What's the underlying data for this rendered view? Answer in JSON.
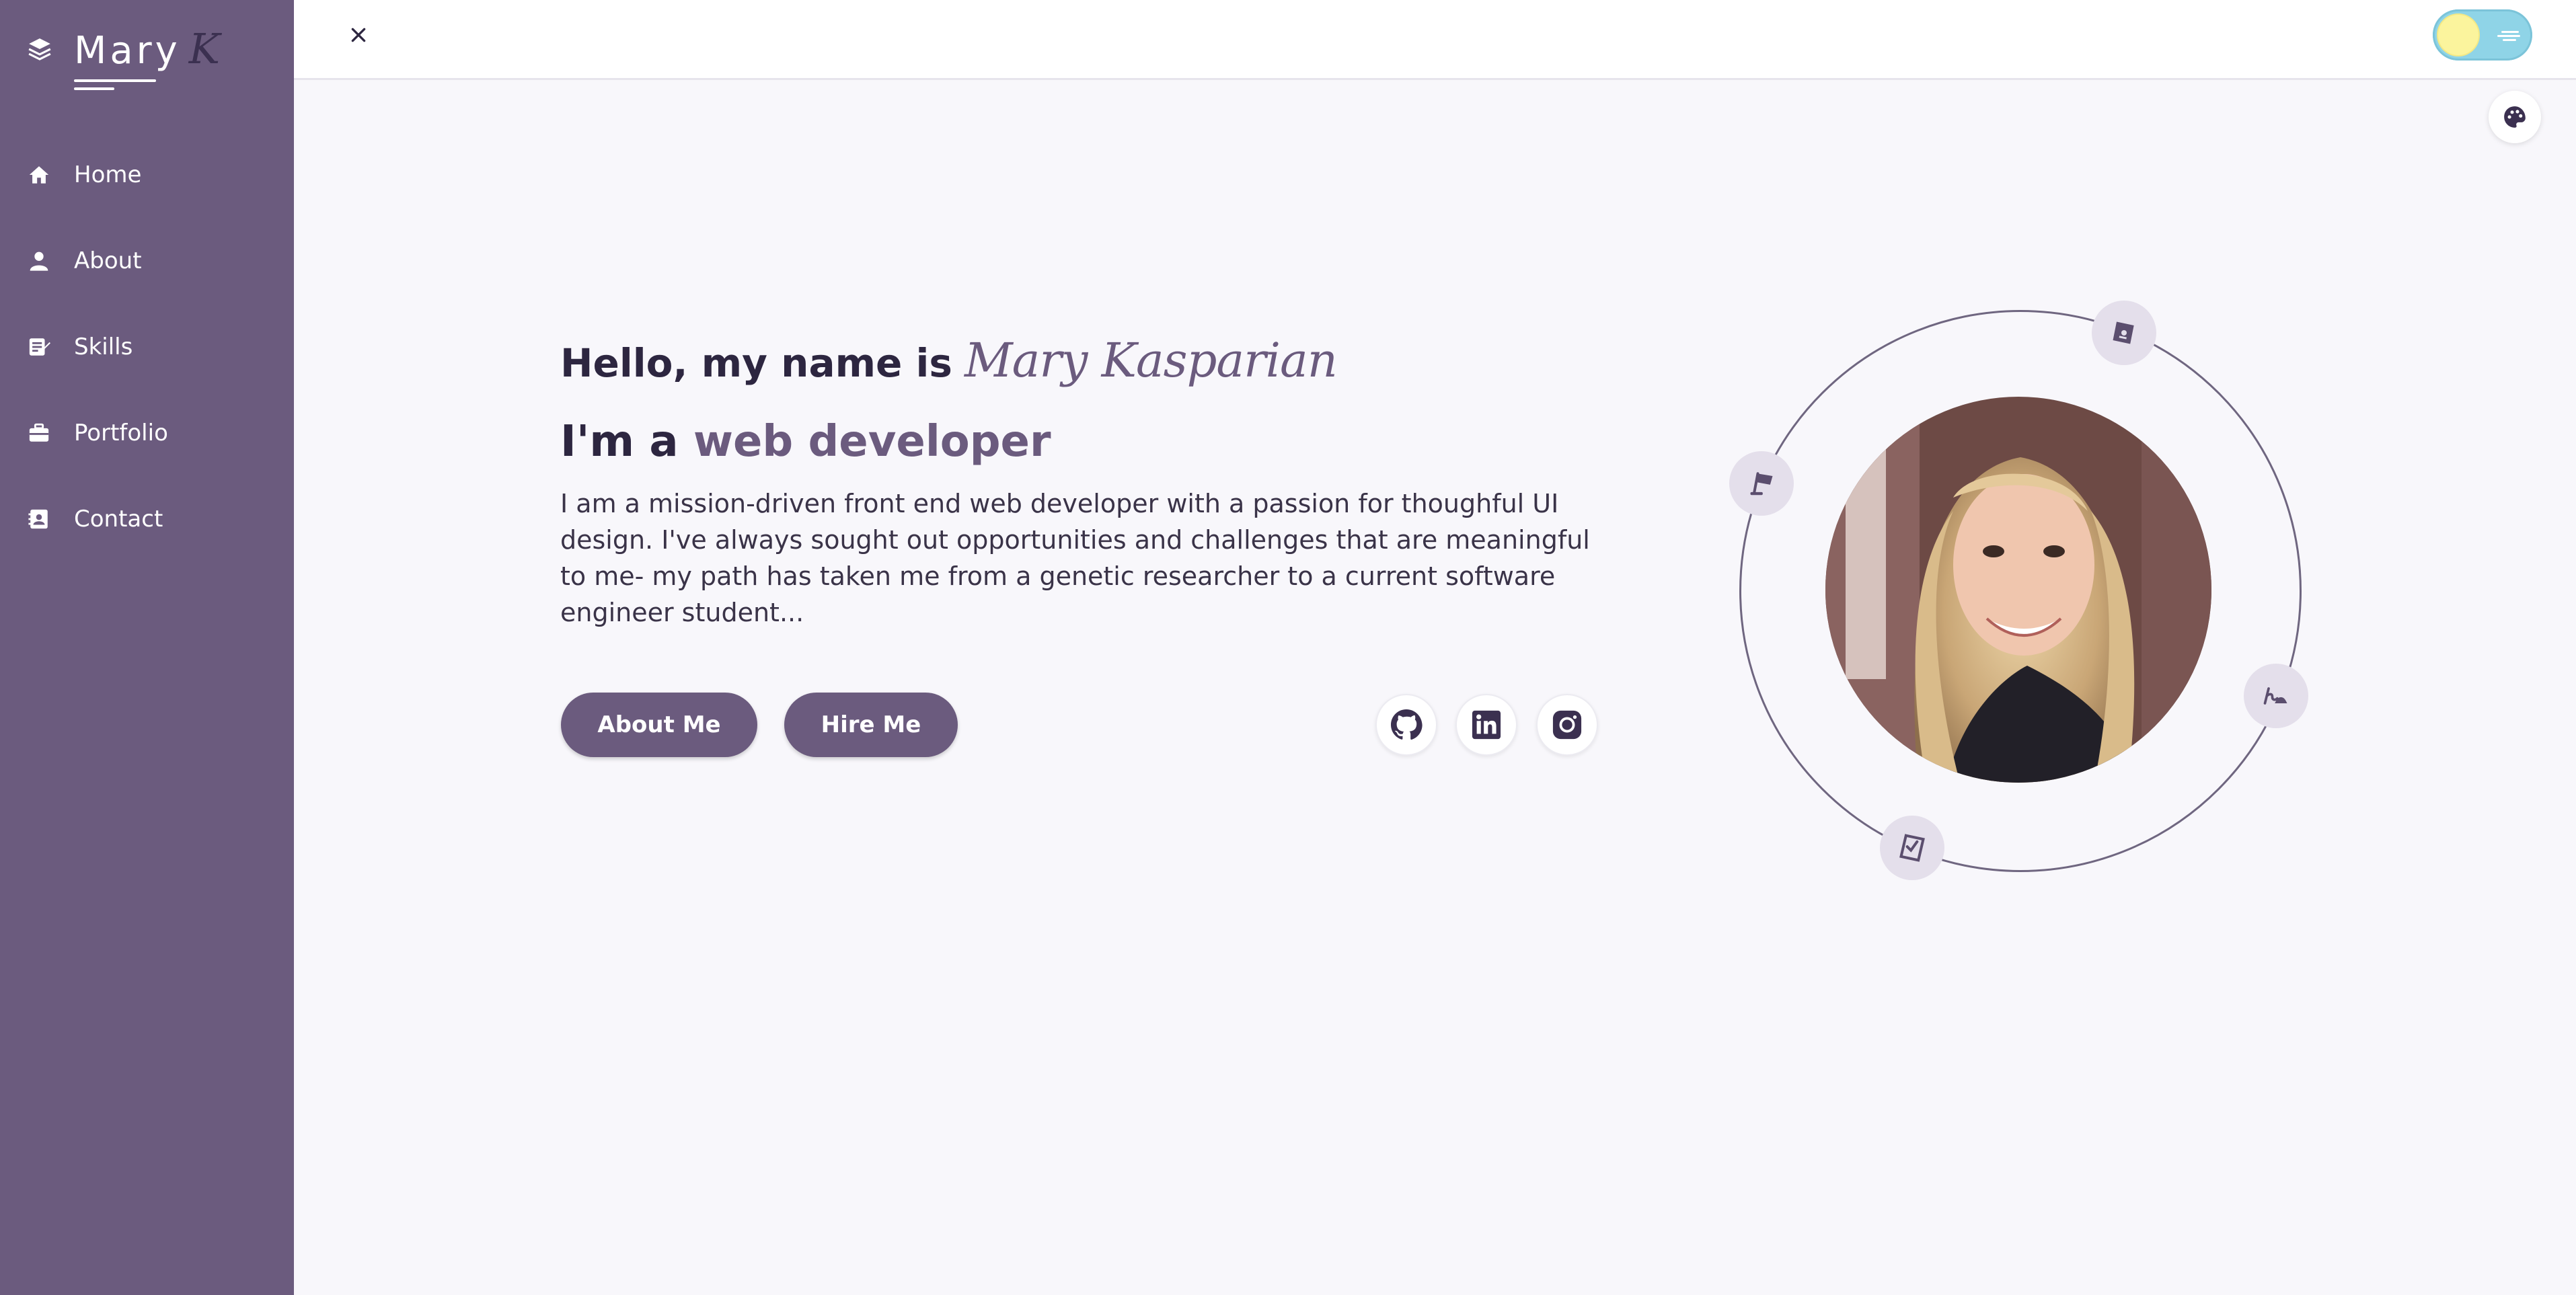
{
  "logo": {
    "name": "Mary",
    "initial": "K"
  },
  "nav": {
    "items": [
      {
        "label": "Home",
        "icon": "home-icon"
      },
      {
        "label": "About",
        "icon": "user-icon"
      },
      {
        "label": "Skills",
        "icon": "skills-icon"
      },
      {
        "label": "Portfolio",
        "icon": "briefcase-icon"
      },
      {
        "label": "Contact",
        "icon": "contact-card-icon"
      }
    ]
  },
  "topbar": {
    "close_icon": "close-icon",
    "theme_toggle": "light"
  },
  "hero": {
    "greeting": "Hello, my name is",
    "name": "Mary Kasparian",
    "role_prefix": "I'm a",
    "role": "web developer",
    "bio": "I am a mission-driven front end web developer with a passion for thoughful UI design. I've always sought out opportunities and challenges that are meaningful to me- my path has taken me from a genetic researcher to a current software engineer student...",
    "about_button": "About Me",
    "hire_button": "Hire Me"
  },
  "social": [
    "github-icon",
    "linkedin-icon",
    "instagram-icon"
  ],
  "colors": {
    "sidebar": "#6b5b7e",
    "accent": "#6b5b7e",
    "background": "#f8f7fb",
    "toggle": "#8fd4e7",
    "toggle_knob": "#fbf49d"
  }
}
